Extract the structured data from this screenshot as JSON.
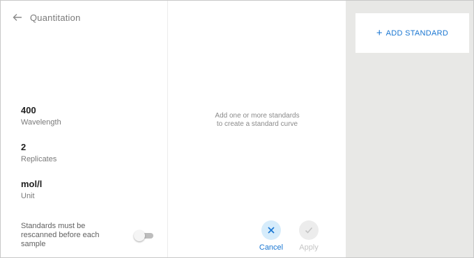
{
  "header": {
    "title": "Quantitation",
    "back_icon": "arrow-left-icon"
  },
  "fields": {
    "wavelength": {
      "value": "400",
      "label": "Wavelength"
    },
    "replicates": {
      "value": "2",
      "label": "Replicates"
    },
    "unit": {
      "value": "mol/l",
      "label": "Unit"
    }
  },
  "rescan_toggle": {
    "label": "Standards must be rescanned before each sample",
    "checked": false
  },
  "standards": {
    "empty_line1": "Add one or more standards",
    "empty_line2": "to create a standard curve"
  },
  "actions": {
    "cancel_label": "Cancel",
    "apply_label": "Apply",
    "apply_enabled": false
  },
  "add_standard": {
    "label": "ADD STANDARD",
    "icon": "plus-icon"
  },
  "colors": {
    "accent": "#1976d2",
    "panel_bg": "#e8e8e6"
  }
}
